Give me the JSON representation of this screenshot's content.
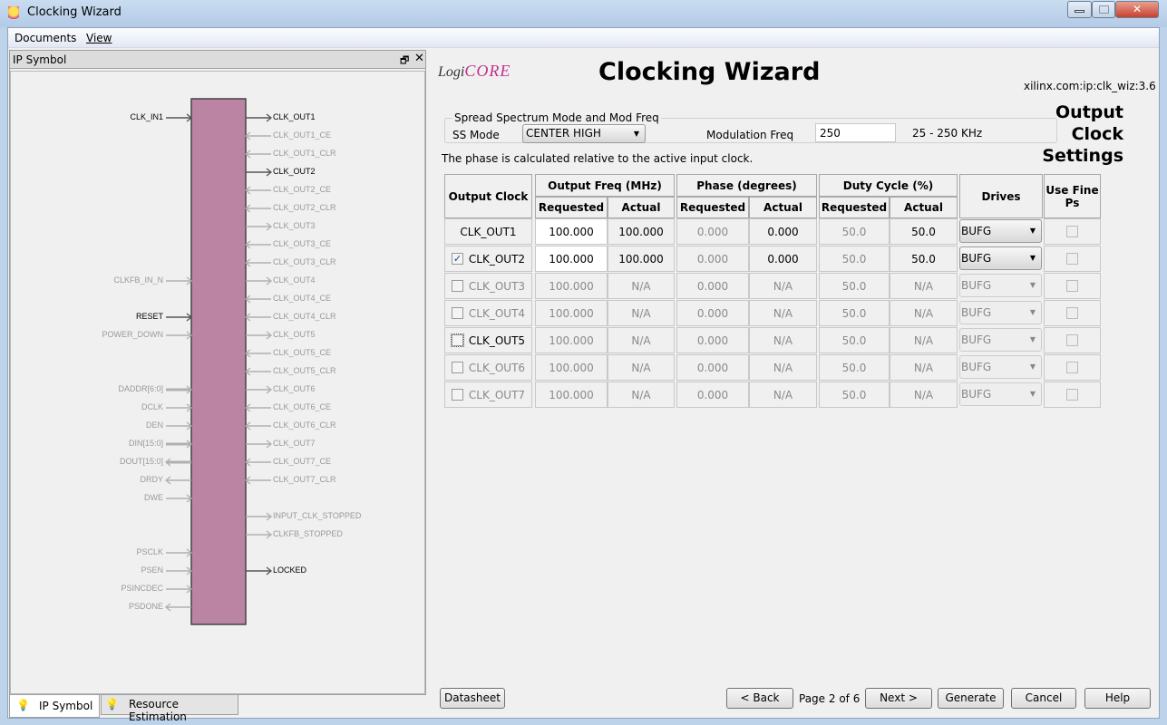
{
  "window": {
    "title": "Clocking Wizard"
  },
  "menu": [
    "Documents",
    "View"
  ],
  "ip_panel": {
    "title": "IP Symbol",
    "left_pins": [
      {
        "name": "CLK_IN1",
        "dir": "in",
        "active": true,
        "bus": false
      },
      {
        "name": "CLKFB_IN_N",
        "dir": "in",
        "active": false,
        "bus": false
      },
      {
        "name": "RESET",
        "dir": "in",
        "active": true,
        "bus": false
      },
      {
        "name": "POWER_DOWN",
        "dir": "in",
        "active": false,
        "bus": false
      },
      {
        "name": "DADDR[6:0]",
        "dir": "in",
        "active": false,
        "bus": true
      },
      {
        "name": "DCLK",
        "dir": "in",
        "active": false,
        "bus": false
      },
      {
        "name": "DEN",
        "dir": "in",
        "active": false,
        "bus": false
      },
      {
        "name": "DIN[15:0]",
        "dir": "in",
        "active": false,
        "bus": true
      },
      {
        "name": "DOUT[15:0]",
        "dir": "out",
        "active": false,
        "bus": true
      },
      {
        "name": "DRDY",
        "dir": "out",
        "active": false,
        "bus": false
      },
      {
        "name": "DWE",
        "dir": "in",
        "active": false,
        "bus": false
      },
      {
        "name": "PSCLK",
        "dir": "in",
        "active": false,
        "bus": false
      },
      {
        "name": "PSEN",
        "dir": "in",
        "active": false,
        "bus": false
      },
      {
        "name": "PSINCDEC",
        "dir": "in",
        "active": false,
        "bus": false
      },
      {
        "name": "PSDONE",
        "dir": "out",
        "active": false,
        "bus": false
      }
    ],
    "right_pins": [
      {
        "name": "CLK_OUT1",
        "dir": "out",
        "active": true
      },
      {
        "name": "CLK_OUT1_CE",
        "dir": "in",
        "active": false
      },
      {
        "name": "CLK_OUT1_CLR",
        "dir": "in",
        "active": false
      },
      {
        "name": "CLK_OUT2",
        "dir": "out",
        "active": true
      },
      {
        "name": "CLK_OUT2_CE",
        "dir": "in",
        "active": false
      },
      {
        "name": "CLK_OUT2_CLR",
        "dir": "in",
        "active": false
      },
      {
        "name": "CLK_OUT3",
        "dir": "out",
        "active": false
      },
      {
        "name": "CLK_OUT3_CE",
        "dir": "in",
        "active": false
      },
      {
        "name": "CLK_OUT3_CLR",
        "dir": "in",
        "active": false
      },
      {
        "name": "CLK_OUT4",
        "dir": "out",
        "active": false
      },
      {
        "name": "CLK_OUT4_CE",
        "dir": "in",
        "active": false
      },
      {
        "name": "CLK_OUT4_CLR",
        "dir": "in",
        "active": false
      },
      {
        "name": "CLK_OUT5",
        "dir": "out",
        "active": false
      },
      {
        "name": "CLK_OUT5_CE",
        "dir": "in",
        "active": false
      },
      {
        "name": "CLK_OUT5_CLR",
        "dir": "in",
        "active": false
      },
      {
        "name": "CLK_OUT6",
        "dir": "out",
        "active": false
      },
      {
        "name": "CLK_OUT6_CE",
        "dir": "in",
        "active": false
      },
      {
        "name": "CLK_OUT6_CLR",
        "dir": "in",
        "active": false
      },
      {
        "name": "CLK_OUT7",
        "dir": "out",
        "active": false
      },
      {
        "name": "CLK_OUT7_CE",
        "dir": "in",
        "active": false
      },
      {
        "name": "CLK_OUT7_CLR",
        "dir": "in",
        "active": false
      },
      {
        "name": "INPUT_CLK_STOPPED",
        "dir": "out",
        "active": false
      },
      {
        "name": "CLKFB_STOPPED",
        "dir": "out",
        "active": false
      },
      {
        "name": "LOCKED",
        "dir": "out",
        "active": true
      }
    ]
  },
  "bottom_tabs": [
    "IP Symbol",
    "Resource Estimation"
  ],
  "header": {
    "logo": "LogiCORE",
    "title": "Clocking Wizard",
    "vlnv": "xilinx.com:ip:clk_wiz:3.6",
    "section": [
      "Output",
      "Clock",
      "Settings"
    ]
  },
  "ss": {
    "group": "Spread Spectrum Mode and Mod Freq",
    "mode_label": "SS Mode",
    "mode_value": "CENTER HIGH",
    "mod_label": "Modulation Freq",
    "mod_value": "250",
    "range": "25 - 250 KHz"
  },
  "note": "The phase is calculated relative to the active input clock.",
  "table": {
    "headers": {
      "output_clock": "Output Clock",
      "freq": "Output Freq (MHz)",
      "phase": "Phase (degrees)",
      "duty": "Duty Cycle (%)",
      "drives": "Drives",
      "fine": "Use Fine Ps",
      "requested": "Requested",
      "actual": "Actual"
    },
    "rows": [
      {
        "name": "CLK_OUT1",
        "checkbox": false,
        "checked": true,
        "enabled": true,
        "freq_req": "100.000",
        "freq_act": "100.000",
        "ph_req": "0.000",
        "ph_act": "0.000",
        "dc_req": "50.0",
        "dc_act": "50.0",
        "drives": "BUFG"
      },
      {
        "name": "CLK_OUT2",
        "checkbox": true,
        "checked": true,
        "enabled": true,
        "freq_req": "100.000",
        "freq_act": "100.000",
        "ph_req": "0.000",
        "ph_act": "0.000",
        "dc_req": "50.0",
        "dc_act": "50.0",
        "drives": "BUFG"
      },
      {
        "name": "CLK_OUT3",
        "checkbox": true,
        "checked": false,
        "enabled": false,
        "freq_req": "100.000",
        "freq_act": "N/A",
        "ph_req": "0.000",
        "ph_act": "N/A",
        "dc_req": "50.0",
        "dc_act": "N/A",
        "drives": "BUFG"
      },
      {
        "name": "CLK_OUT4",
        "checkbox": true,
        "checked": false,
        "enabled": false,
        "freq_req": "100.000",
        "freq_act": "N/A",
        "ph_req": "0.000",
        "ph_act": "N/A",
        "dc_req": "50.0",
        "dc_act": "N/A",
        "drives": "BUFG"
      },
      {
        "name": "CLK_OUT5",
        "checkbox": true,
        "checked": false,
        "enabled": false,
        "focus": true,
        "freq_req": "100.000",
        "freq_act": "N/A",
        "ph_req": "0.000",
        "ph_act": "N/A",
        "dc_req": "50.0",
        "dc_act": "N/A",
        "drives": "BUFG"
      },
      {
        "name": "CLK_OUT6",
        "checkbox": true,
        "checked": false,
        "enabled": false,
        "freq_req": "100.000",
        "freq_act": "N/A",
        "ph_req": "0.000",
        "ph_act": "N/A",
        "dc_req": "50.0",
        "dc_act": "N/A",
        "drives": "BUFG"
      },
      {
        "name": "CLK_OUT7",
        "checkbox": true,
        "checked": false,
        "enabled": false,
        "freq_req": "100.000",
        "freq_act": "N/A",
        "ph_req": "0.000",
        "ph_act": "N/A",
        "dc_req": "50.0",
        "dc_act": "N/A",
        "drives": "BUFG"
      }
    ]
  },
  "footer": {
    "datasheet": "Datasheet",
    "back": "< Back",
    "page": "Page 2 of 6",
    "next": "Next >",
    "generate": "Generate",
    "cancel": "Cancel",
    "help": "Help"
  },
  "colors": {
    "block": "#bb84a2",
    "accent": "#d04020"
  }
}
